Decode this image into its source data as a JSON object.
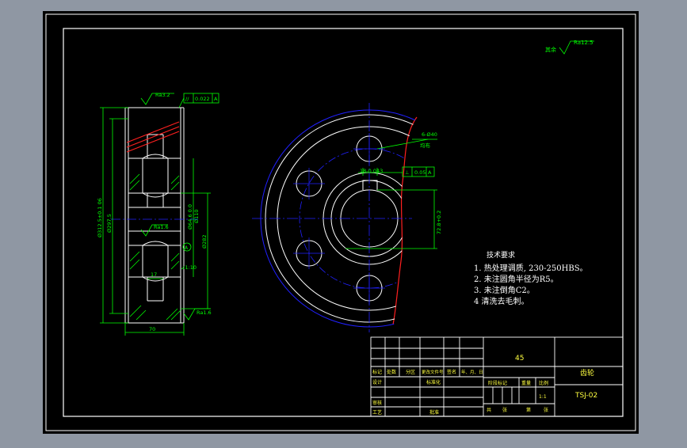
{
  "colors": {
    "frame_bg": "#000000",
    "outer_bg": "#8f97a3",
    "line_white": "#ffffff",
    "line_green": "#00ff00",
    "line_blue": "#2020ff",
    "line_red": "#ff2020",
    "line_cyan": "#00ffff"
  },
  "side_view": {
    "roughness_top": "Ra3.2",
    "tolerance_symbol": "//",
    "tolerance_value": "0.022",
    "datum": "A",
    "dim_od": "Ø312.5±0.1 06",
    "dim_root": "Ø297.5",
    "dim_hub": "Ø64.6 0.0",
    "dim_bore": "Ø110",
    "dim_mid": "Ø282",
    "roughness_mid": "Ra1.6",
    "roughness_bottom": "Ra1.6",
    "taper": "⊿1:10",
    "dim_17": "17",
    "dim_70": "70",
    "datum_circle": "A"
  },
  "front_view": {
    "hole_label": "6-Ø40",
    "hole_note": "均布",
    "keyway_width": "18-0.043",
    "keyway_tol_sym": "⊥",
    "keyway_tol_val": "0.05",
    "keyway_datum": "A",
    "dim_depth": "72.8+0.2"
  },
  "top_right": {
    "label": "其余",
    "roughness": "Ra12.5"
  },
  "tech_requirements": {
    "title": "技术要求",
    "items": [
      "1.  热处理调质, 230-250HBS。",
      "2.  未注圆角半径为R5。",
      "3.  未注倒角C2。",
      "4   清洗去毛刺。"
    ]
  },
  "title_block": {
    "material": "45",
    "part_name": "齿轮",
    "drawing_no": "TSJ-02",
    "scale": "1:1",
    "row_headers": [
      "标记",
      "处数",
      "分区",
      "更改文件号",
      "签名",
      "年、月、日"
    ],
    "labels": {
      "designer": "设计",
      "standardize": "标准化",
      "stage_mark": "阶段标记",
      "weight": "重量",
      "ratio": "比例",
      "reviewer": "审核",
      "process": "工艺",
      "approve": "批准",
      "sheet_total": "共",
      "sheet_of": "张",
      "sheet_no": "第",
      "sheet_unit": "张"
    }
  }
}
